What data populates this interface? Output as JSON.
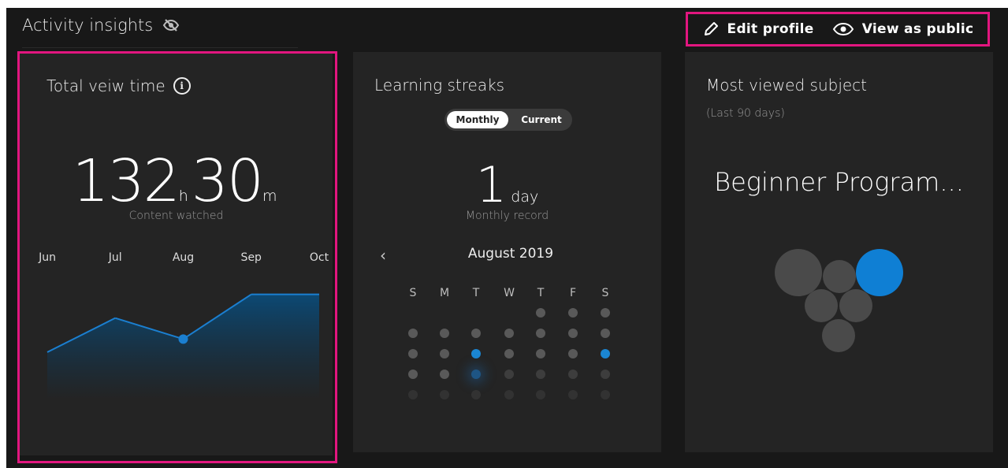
{
  "header": {
    "title": "Activity insights",
    "edit_profile": "Edit profile",
    "view_as_public": "View as public"
  },
  "view_time": {
    "title": "Total veiw time",
    "hours": "132",
    "hours_unit": "h",
    "minutes": "30",
    "minutes_unit": "m",
    "label": "Content watched"
  },
  "chart_data": {
    "type": "area",
    "categories": [
      "Jun",
      "Jul",
      "Aug",
      "Sep",
      "Oct"
    ],
    "values": [
      18,
      31,
      23,
      40,
      40
    ],
    "ylim": [
      0,
      45
    ],
    "highlighted_category": "Aug",
    "grid": false,
    "color": "#1b7fd0"
  },
  "streaks": {
    "title": "Learning streaks",
    "toggle_monthly": "Monthly",
    "toggle_current": "Current",
    "value": "1",
    "unit": "day",
    "label": "Monthly record",
    "calendar": {
      "prev": "‹",
      "month_label": "August 2019",
      "weekdays": [
        "S",
        "M",
        "T",
        "W",
        "T",
        "F",
        "S"
      ],
      "first_weekday_index": 4,
      "days_shown": 31,
      "active_days": [
        13,
        17
      ],
      "today": 20
    }
  },
  "subject": {
    "title": "Most viewed subject",
    "subtitle": "(Last 90 days)",
    "name": "Beginner Program..."
  },
  "colors": {
    "background": "#181818",
    "card": "#242424",
    "accent_blue": "#1b86d2",
    "highlight_pink": "#e2167f"
  }
}
